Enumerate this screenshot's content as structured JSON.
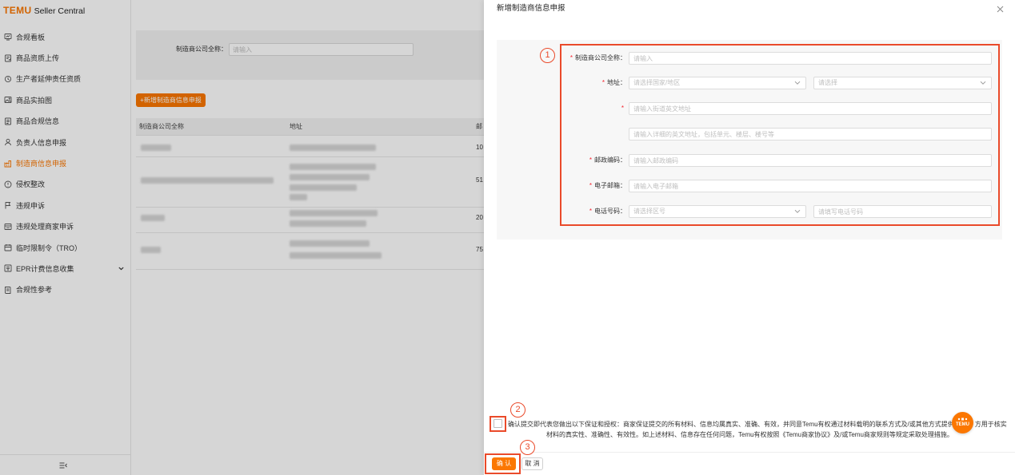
{
  "app": {
    "brand": "TEMU",
    "product": "Seller Central"
  },
  "colors": {
    "accent": "#fb7701",
    "annotation": "#ea4a2a",
    "required": "#f5222d"
  },
  "sidebar": {
    "active_index": 6,
    "items": [
      {
        "label": "合规看板",
        "icon": "dashboard-icon"
      },
      {
        "label": "商品资质上传",
        "icon": "certificate-icon"
      },
      {
        "label": "生产者延伸责任资质",
        "icon": "recycle-icon"
      },
      {
        "label": "商品实拍图",
        "icon": "image-icon"
      },
      {
        "label": "商品合规信息",
        "icon": "document-icon"
      },
      {
        "label": "负责人信息申报",
        "icon": "person-icon"
      },
      {
        "label": "制造商信息申报",
        "icon": "factory-icon"
      },
      {
        "label": "侵权整改",
        "icon": "alert-circle-icon"
      },
      {
        "label": "违规申诉",
        "icon": "flag-icon"
      },
      {
        "label": "违规处理商家申诉",
        "icon": "list-icon"
      },
      {
        "label": "临时限制令（TRO）",
        "icon": "calendar-icon"
      },
      {
        "label": "EPR计费信息收集",
        "icon": "receipt-icon",
        "has_submenu": true
      },
      {
        "label": "合规性参考",
        "icon": "book-icon"
      }
    ],
    "collapse_icon": "menu-collapse-icon"
  },
  "main": {
    "filter": {
      "label": "制造商公司全称：",
      "placeholder": "请输入"
    },
    "add_button": "+新增制造商信息申报",
    "table": {
      "columns": [
        "制造商公司全称",
        "地址",
        "邮"
      ],
      "rows": [
        {
          "col3": "10"
        },
        {
          "col3": "51"
        },
        {
          "col3": "20"
        },
        {
          "col3": "75"
        }
      ]
    }
  },
  "drawer": {
    "title": "新增制造商信息申报",
    "close_icon": "close-icon",
    "required_mark": "*",
    "form": {
      "company_name": {
        "label": "制造商公司全称：",
        "placeholder": "请输入"
      },
      "address": {
        "label": "地址：",
        "country_placeholder": "请选择国家/地区",
        "region_placeholder": "请选择",
        "street_placeholder": "请输入街道英文地址",
        "detail_placeholder": "请输入详细的英文地址，包括单元、楼层、楼号等"
      },
      "postal_code": {
        "label": "邮政编码：",
        "placeholder": "请输入邮政编码"
      },
      "email": {
        "label": "电子邮箱：",
        "placeholder": "请输入电子邮箱"
      },
      "phone": {
        "label": "电话号码：",
        "area_code_placeholder": "请选择区号",
        "number_placeholder": "请填写电话号码"
      }
    },
    "agreement": {
      "checked": false,
      "line1_before": "确认提交即代表您做出以下保证和授权：商家保证提交的所有材料、信息均属真实、准确、有效，并同意Temu有权通过材料载明的联系方式及/或其他方式提供",
      "line1_after": "方用于核实",
      "line2": "材料的真实性、准确性、有效性。如上述材料、信息存在任何问题，Temu有权按照《Temu商家协议》及/或Temu商家规则等规定采取处理措施。"
    },
    "float_badge": {
      "label": "TEMU"
    },
    "footer": {
      "confirm": "确 认",
      "cancel": "取 消"
    }
  },
  "annotations": {
    "markers": [
      "1",
      "2",
      "3"
    ]
  }
}
